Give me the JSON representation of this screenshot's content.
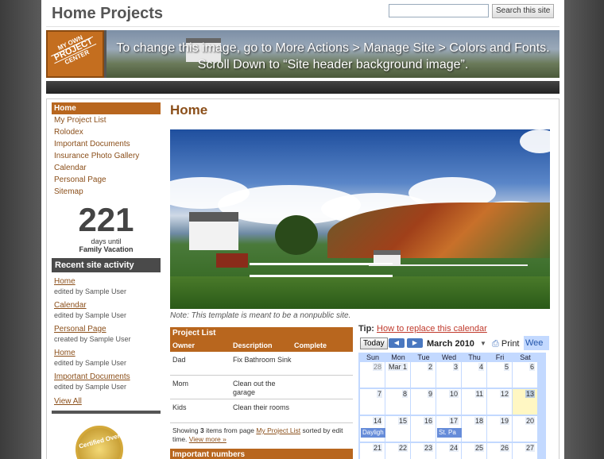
{
  "header": {
    "site_title": "Home Projects",
    "search_placeholder": "",
    "search_button": "Search this site"
  },
  "banner": {
    "logo_lines": [
      "MY OWN",
      "PROJECT",
      "CENTER"
    ],
    "message_line1": "To change this image, go to More Actions > Manage Site > Colors and Fonts.",
    "message_line2": "Scroll Down to “Site header background image”."
  },
  "sidebar": {
    "items": [
      {
        "label": "Home",
        "active": true
      },
      {
        "label": "My Project List"
      },
      {
        "label": "Rolodex"
      },
      {
        "label": "Important Documents"
      },
      {
        "label": "Insurance Photo Gallery"
      },
      {
        "label": "Calendar"
      },
      {
        "label": "Personal Page"
      },
      {
        "label": "Sitemap"
      }
    ],
    "countdown": {
      "number": "221",
      "line1": "days until",
      "line2": "Family Vacation"
    },
    "activity_title": "Recent site activity",
    "activity": [
      {
        "page": "Home",
        "action": "edited by Sample User"
      },
      {
        "page": "Calendar",
        "action": "edited by Sample User"
      },
      {
        "page": "Personal Page",
        "action": "created by Sample User"
      },
      {
        "page": "Home",
        "action": "edited by Sample User"
      },
      {
        "page": "Important Documents",
        "action": "edited by Sample User"
      }
    ],
    "view_all": "View All",
    "seal_text": "Certified Over"
  },
  "main": {
    "page_title": "Home",
    "note": "Note: This template is meant to be a nonpublic site."
  },
  "project_list": {
    "title": "Project List",
    "columns": [
      "Owner",
      "Description",
      "Complete"
    ],
    "rows": [
      {
        "owner": "Dad",
        "description": "Fix Bathroom Sink",
        "complete": ""
      },
      {
        "owner": "Mom",
        "description": "Clean out the garage",
        "complete": ""
      },
      {
        "owner": "Kids",
        "description": "Clean their rooms",
        "complete": ""
      }
    ],
    "footer_prefix": "Showing ",
    "footer_count": "3",
    "footer_mid": " items from page ",
    "footer_link": "My Project List",
    "footer_suffix": " sorted by edit time. ",
    "view_more": "View more »",
    "important_title": "Important numbers"
  },
  "calendar": {
    "tip_label": "Tip:",
    "tip_link": "How to replace this calendar",
    "today": "Today",
    "month": "March 2010",
    "print": "Print",
    "week_tab": "Wee",
    "days_of_week": [
      "Sun",
      "Mon",
      "Tue",
      "Wed",
      "Thu",
      "Fri",
      "Sat"
    ],
    "weeks": [
      [
        {
          "n": "28",
          "other": true
        },
        {
          "n": "Mar 1"
        },
        {
          "n": "2"
        },
        {
          "n": "3"
        },
        {
          "n": "4"
        },
        {
          "n": "5"
        },
        {
          "n": "6"
        }
      ],
      [
        {
          "n": "7"
        },
        {
          "n": "8"
        },
        {
          "n": "9"
        },
        {
          "n": "10"
        },
        {
          "n": "11"
        },
        {
          "n": "12"
        },
        {
          "n": "13",
          "today": true
        }
      ],
      [
        {
          "n": "14",
          "event": "Dayligh"
        },
        {
          "n": "15"
        },
        {
          "n": "16"
        },
        {
          "n": "17",
          "event": "St. Pa"
        },
        {
          "n": "18"
        },
        {
          "n": "19"
        },
        {
          "n": "20"
        }
      ],
      [
        {
          "n": "21"
        },
        {
          "n": "22"
        },
        {
          "n": "23"
        },
        {
          "n": "24"
        },
        {
          "n": "25"
        },
        {
          "n": "26"
        },
        {
          "n": "27"
        }
      ]
    ],
    "colors": {
      "grid": "#c3d9ff",
      "event": "#668cd9",
      "today": "#fff7c3"
    }
  },
  "colors": {
    "accent": "#b8661e",
    "link": "#8b4f1a",
    "dark": "#4a4a4a"
  }
}
